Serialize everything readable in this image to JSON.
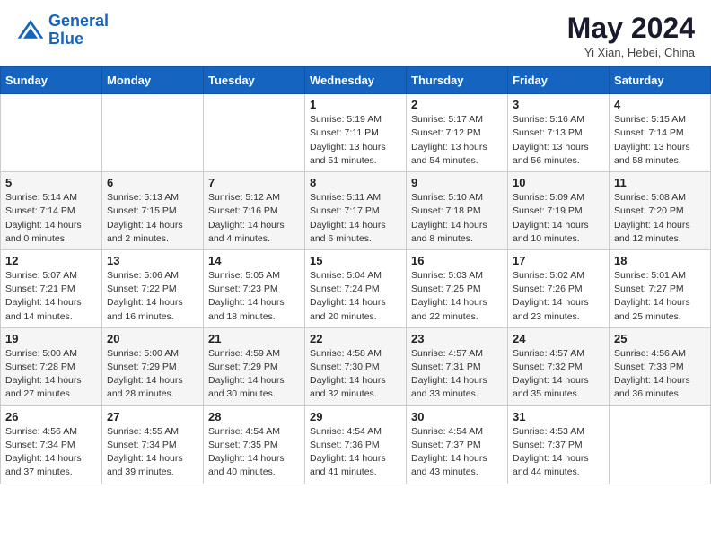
{
  "header": {
    "logo_line1": "General",
    "logo_line2": "Blue",
    "month": "May 2024",
    "location": "Yi Xian, Hebei, China"
  },
  "weekdays": [
    "Sunday",
    "Monday",
    "Tuesday",
    "Wednesday",
    "Thursday",
    "Friday",
    "Saturday"
  ],
  "weeks": [
    [
      {
        "day": "",
        "info": ""
      },
      {
        "day": "",
        "info": ""
      },
      {
        "day": "",
        "info": ""
      },
      {
        "day": "1",
        "info": "Sunrise: 5:19 AM\nSunset: 7:11 PM\nDaylight: 13 hours\nand 51 minutes."
      },
      {
        "day": "2",
        "info": "Sunrise: 5:17 AM\nSunset: 7:12 PM\nDaylight: 13 hours\nand 54 minutes."
      },
      {
        "day": "3",
        "info": "Sunrise: 5:16 AM\nSunset: 7:13 PM\nDaylight: 13 hours\nand 56 minutes."
      },
      {
        "day": "4",
        "info": "Sunrise: 5:15 AM\nSunset: 7:14 PM\nDaylight: 13 hours\nand 58 minutes."
      }
    ],
    [
      {
        "day": "5",
        "info": "Sunrise: 5:14 AM\nSunset: 7:14 PM\nDaylight: 14 hours\nand 0 minutes."
      },
      {
        "day": "6",
        "info": "Sunrise: 5:13 AM\nSunset: 7:15 PM\nDaylight: 14 hours\nand 2 minutes."
      },
      {
        "day": "7",
        "info": "Sunrise: 5:12 AM\nSunset: 7:16 PM\nDaylight: 14 hours\nand 4 minutes."
      },
      {
        "day": "8",
        "info": "Sunrise: 5:11 AM\nSunset: 7:17 PM\nDaylight: 14 hours\nand 6 minutes."
      },
      {
        "day": "9",
        "info": "Sunrise: 5:10 AM\nSunset: 7:18 PM\nDaylight: 14 hours\nand 8 minutes."
      },
      {
        "day": "10",
        "info": "Sunrise: 5:09 AM\nSunset: 7:19 PM\nDaylight: 14 hours\nand 10 minutes."
      },
      {
        "day": "11",
        "info": "Sunrise: 5:08 AM\nSunset: 7:20 PM\nDaylight: 14 hours\nand 12 minutes."
      }
    ],
    [
      {
        "day": "12",
        "info": "Sunrise: 5:07 AM\nSunset: 7:21 PM\nDaylight: 14 hours\nand 14 minutes."
      },
      {
        "day": "13",
        "info": "Sunrise: 5:06 AM\nSunset: 7:22 PM\nDaylight: 14 hours\nand 16 minutes."
      },
      {
        "day": "14",
        "info": "Sunrise: 5:05 AM\nSunset: 7:23 PM\nDaylight: 14 hours\nand 18 minutes."
      },
      {
        "day": "15",
        "info": "Sunrise: 5:04 AM\nSunset: 7:24 PM\nDaylight: 14 hours\nand 20 minutes."
      },
      {
        "day": "16",
        "info": "Sunrise: 5:03 AM\nSunset: 7:25 PM\nDaylight: 14 hours\nand 22 minutes."
      },
      {
        "day": "17",
        "info": "Sunrise: 5:02 AM\nSunset: 7:26 PM\nDaylight: 14 hours\nand 23 minutes."
      },
      {
        "day": "18",
        "info": "Sunrise: 5:01 AM\nSunset: 7:27 PM\nDaylight: 14 hours\nand 25 minutes."
      }
    ],
    [
      {
        "day": "19",
        "info": "Sunrise: 5:00 AM\nSunset: 7:28 PM\nDaylight: 14 hours\nand 27 minutes."
      },
      {
        "day": "20",
        "info": "Sunrise: 5:00 AM\nSunset: 7:29 PM\nDaylight: 14 hours\nand 28 minutes."
      },
      {
        "day": "21",
        "info": "Sunrise: 4:59 AM\nSunset: 7:29 PM\nDaylight: 14 hours\nand 30 minutes."
      },
      {
        "day": "22",
        "info": "Sunrise: 4:58 AM\nSunset: 7:30 PM\nDaylight: 14 hours\nand 32 minutes."
      },
      {
        "day": "23",
        "info": "Sunrise: 4:57 AM\nSunset: 7:31 PM\nDaylight: 14 hours\nand 33 minutes."
      },
      {
        "day": "24",
        "info": "Sunrise: 4:57 AM\nSunset: 7:32 PM\nDaylight: 14 hours\nand 35 minutes."
      },
      {
        "day": "25",
        "info": "Sunrise: 4:56 AM\nSunset: 7:33 PM\nDaylight: 14 hours\nand 36 minutes."
      }
    ],
    [
      {
        "day": "26",
        "info": "Sunrise: 4:56 AM\nSunset: 7:34 PM\nDaylight: 14 hours\nand 37 minutes."
      },
      {
        "day": "27",
        "info": "Sunrise: 4:55 AM\nSunset: 7:34 PM\nDaylight: 14 hours\nand 39 minutes."
      },
      {
        "day": "28",
        "info": "Sunrise: 4:54 AM\nSunset: 7:35 PM\nDaylight: 14 hours\nand 40 minutes."
      },
      {
        "day": "29",
        "info": "Sunrise: 4:54 AM\nSunset: 7:36 PM\nDaylight: 14 hours\nand 41 minutes."
      },
      {
        "day": "30",
        "info": "Sunrise: 4:54 AM\nSunset: 7:37 PM\nDaylight: 14 hours\nand 43 minutes."
      },
      {
        "day": "31",
        "info": "Sunrise: 4:53 AM\nSunset: 7:37 PM\nDaylight: 14 hours\nand 44 minutes."
      },
      {
        "day": "",
        "info": ""
      }
    ]
  ]
}
